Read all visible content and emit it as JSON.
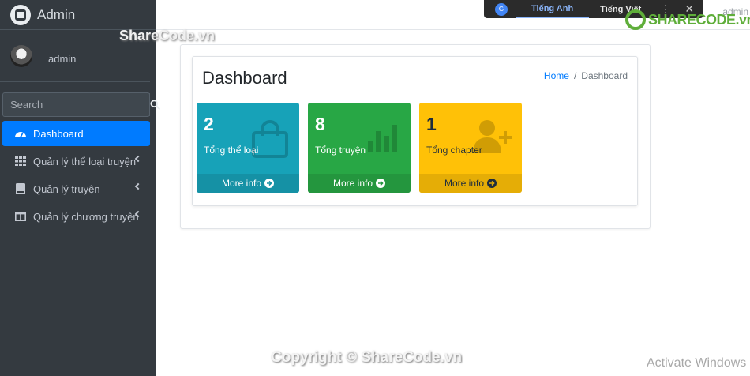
{
  "brand": {
    "title": "Admin"
  },
  "user": {
    "name": "admin"
  },
  "search": {
    "placeholder": "Search"
  },
  "nav": {
    "items": [
      {
        "label": "Dashboard"
      },
      {
        "label": "Quản lý thể loại truyện"
      },
      {
        "label": "Quản lý truyện"
      },
      {
        "label": "Quản lý chương truyện"
      }
    ]
  },
  "translate": {
    "lang_en": "Tiếng Anh",
    "lang_vi": "Tiếng Việt",
    "menu": "⋮",
    "close": "✕",
    "g": "G"
  },
  "topbar": {
    "user": "admin"
  },
  "page": {
    "title": "Dashboard"
  },
  "breadcrumb": {
    "home": "Home",
    "separator": "/",
    "current": "Dashboard"
  },
  "stats": [
    {
      "value": "2",
      "label": "Tổng thể loại",
      "footer": "More info",
      "icon": "shopping-bag-icon",
      "color": "#17a2b8"
    },
    {
      "value": "8",
      "label": "Tổng truyện",
      "footer": "More info",
      "icon": "bar-chart-icon",
      "color": "#28a745"
    },
    {
      "value": "1",
      "label": "Tổng chapter",
      "footer": "More info",
      "icon": "user-plus-icon",
      "color": "#ffc107"
    }
  ],
  "watermarks": {
    "top": "ShareCode.vn",
    "logo": "SHARECODE.vn",
    "bottom": "Copyright © ShareCode.vn"
  },
  "os": {
    "activate": "Activate Windows"
  }
}
